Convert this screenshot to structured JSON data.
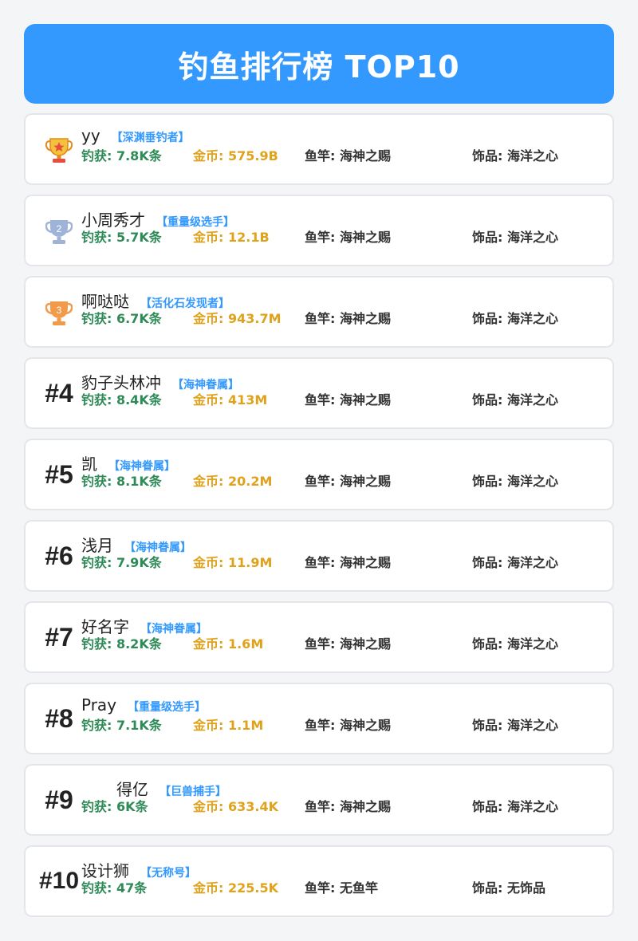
{
  "header": {
    "title": "钓鱼排行榜 TOP10"
  },
  "labels": {
    "catch": "钓获",
    "gold": "金币",
    "rod": "鱼竿",
    "accessory": "饰品"
  },
  "colors": {
    "banner": "#3399ff",
    "title_tag": "#3399ff",
    "catch": "#2e8b57",
    "gold": "#e0a21b",
    "silver_trophy": "#9fb3d9",
    "bronze_trophy": "#f39a4a"
  },
  "rows": [
    {
      "rank": "1",
      "rank_label": "",
      "icon": "gold-trophy-icon",
      "name": "yy",
      "title": "【深渊垂钓者】",
      "catch": "钓获: 7.8K条",
      "gold": "金币: 575.9B",
      "rod": "鱼竿: 海神之赐",
      "accessory": "饰品: 海洋之心"
    },
    {
      "rank": "2",
      "rank_label": "2",
      "icon": "silver-trophy-icon",
      "name": "小周秀才",
      "title": "【重量级选手】",
      "catch": "钓获: 5.7K条",
      "gold": "金币: 12.1B",
      "rod": "鱼竿: 海神之赐",
      "accessory": "饰品: 海洋之心"
    },
    {
      "rank": "3",
      "rank_label": "3",
      "icon": "bronze-trophy-icon",
      "name": "啊哒哒",
      "title": "【活化石发现者】",
      "catch": "钓获: 6.7K条",
      "gold": "金币: 943.7M",
      "rod": "鱼竿: 海神之赐",
      "accessory": "饰品: 海洋之心"
    },
    {
      "rank": "#4",
      "name": "豹子头林冲",
      "title": "【海神眷属】",
      "catch": "钓获: 8.4K条",
      "gold": "金币: 413M",
      "rod": "鱼竿: 海神之赐",
      "accessory": "饰品: 海洋之心"
    },
    {
      "rank": "#5",
      "name": "凯",
      "title": "【海神眷属】",
      "catch": "钓获: 8.1K条",
      "gold": "金币: 20.2M",
      "rod": "鱼竿: 海神之赐",
      "accessory": "饰品: 海洋之心"
    },
    {
      "rank": "#6",
      "name": "浅月",
      "title": "【海神眷属】",
      "catch": "钓获: 7.9K条",
      "gold": "金币: 11.9M",
      "rod": "鱼竿: 海神之赐",
      "accessory": "饰品: 海洋之心"
    },
    {
      "rank": "#7",
      "name": "好名字",
      "title": "【海神眷属】",
      "catch": "钓获: 8.2K条",
      "gold": "金币: 1.6M",
      "rod": "鱼竿: 海神之赐",
      "accessory": "饰品: 海洋之心"
    },
    {
      "rank": "#8",
      "name": "Pray",
      "title": "【重量级选手】",
      "catch": "钓获: 7.1K条",
      "gold": "金币: 1.1M",
      "rod": "鱼竿: 海神之赐",
      "accessory": "饰品: 海洋之心"
    },
    {
      "rank": "#9",
      "name": "得亿",
      "title": "【巨兽捕手】",
      "catch": "钓获: 6K条",
      "gold": "金币: 633.4K",
      "rod": "鱼竿: 海神之赐",
      "accessory": "饰品: 海洋之心"
    },
    {
      "rank": "#10",
      "name": "设计狮",
      "title": "【无称号】",
      "catch": "钓获: 47条",
      "gold": "金币: 225.5K",
      "rod": "鱼竿: 无鱼竿",
      "accessory": "饰品: 无饰品"
    }
  ]
}
